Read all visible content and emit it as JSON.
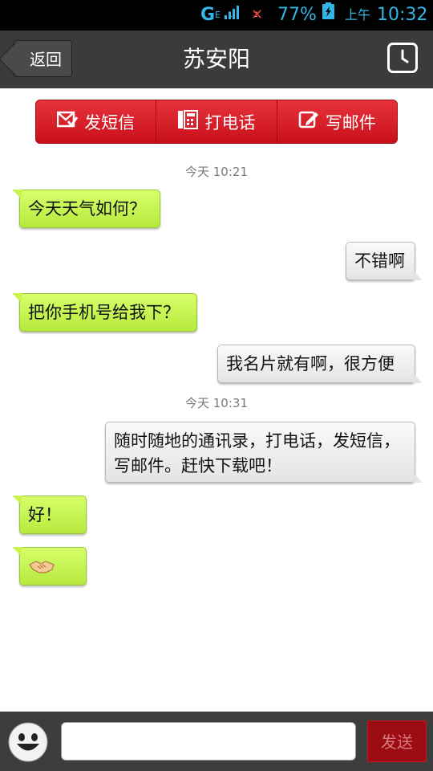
{
  "status_bar": {
    "network_g": "G",
    "network_e": "E",
    "sim1": "1",
    "sim2": "2",
    "battery_percent": "77%",
    "ampm": "上午",
    "time": "10:32",
    "accent": "#33b5e5"
  },
  "header": {
    "back_label": "返回",
    "title": "苏安阳",
    "history_icon": "clock-icon"
  },
  "actions": [
    {
      "label": "发短信",
      "icon": "sms-icon"
    },
    {
      "label": "打电话",
      "icon": "phone-icon"
    },
    {
      "label": "写邮件",
      "icon": "edit-mail-icon"
    }
  ],
  "chat": {
    "timestamps": [
      "今天 10:21",
      "今天 10:31"
    ],
    "messages": [
      {
        "from": "contact",
        "text": "今天天气如何？"
      },
      {
        "from": "me",
        "text": "不错啊"
      },
      {
        "from": "contact",
        "text": "把你手机号给我下？"
      },
      {
        "from": "me",
        "text": "我名片就有啊，很方便"
      },
      {
        "from": "me",
        "text": "随时随地的通讯录，打电话，发短信，写邮件。赶快下载吧！"
      },
      {
        "from": "contact",
        "text": "好！"
      },
      {
        "from": "contact",
        "text": "",
        "icon": "handshake-emoji-icon"
      }
    ]
  },
  "input_bar": {
    "placeholder": "",
    "send_label": "发送",
    "emoji_icon": "smiley-icon"
  },
  "colors": {
    "incoming_bubble": "#c7f44f",
    "outgoing_bubble": "#ececec",
    "action_bar": "#d8202a",
    "header_bg": "#3b3b3b"
  }
}
